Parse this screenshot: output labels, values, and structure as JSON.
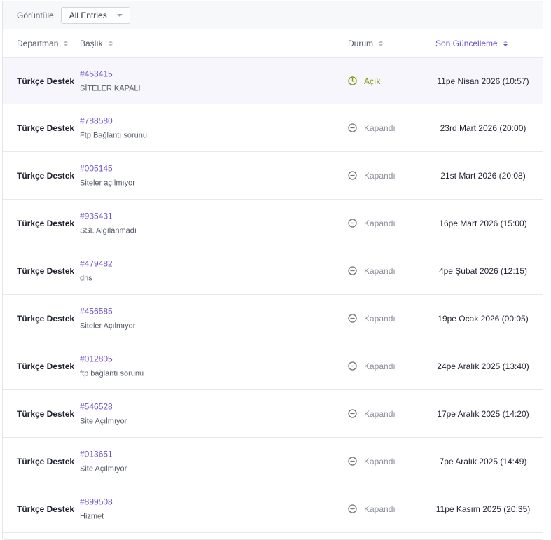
{
  "filter": {
    "label": "Görüntüle",
    "selected": "All Entries"
  },
  "columns": {
    "department": "Departman",
    "title": "Başlık",
    "status": "Durum",
    "updated": "Son Güncelleme"
  },
  "colors": {
    "accent": "#6f52c7",
    "open": "#7a9a10",
    "closed": "#8a8f99"
  },
  "tickets": [
    {
      "department": "Türkçe Destek",
      "id": "#453415",
      "subject": "SİTELER KAPALI",
      "status": "Açık",
      "status_key": "open",
      "updated": "11pe Nisan 2026 (10:57)"
    },
    {
      "department": "Türkçe Destek",
      "id": "#788580",
      "subject": "Ftp Bağlantı sorunu",
      "status": "Kapandı",
      "status_key": "closed",
      "updated": "23rd Mart 2026 (20:00)"
    },
    {
      "department": "Türkçe Destek",
      "id": "#005145",
      "subject": "Siteler açılmıyor",
      "status": "Kapandı",
      "status_key": "closed",
      "updated": "21st Mart 2026 (20:08)"
    },
    {
      "department": "Türkçe Destek",
      "id": "#935431",
      "subject": "SSL Algılanmadı",
      "status": "Kapandı",
      "status_key": "closed",
      "updated": "16pe Mart 2026 (15:00)"
    },
    {
      "department": "Türkçe Destek",
      "id": "#479482",
      "subject": "dns",
      "status": "Kapandı",
      "status_key": "closed",
      "updated": "4pe Şubat 2026 (12:15)"
    },
    {
      "department": "Türkçe Destek",
      "id": "#456585",
      "subject": "Siteler Açılmıyor",
      "status": "Kapandı",
      "status_key": "closed",
      "updated": "19pe Ocak 2026 (00:05)"
    },
    {
      "department": "Türkçe Destek",
      "id": "#012805",
      "subject": "ftp bağlantı sorunu",
      "status": "Kapandı",
      "status_key": "closed",
      "updated": "24pe Aralık 2025 (13:40)"
    },
    {
      "department": "Türkçe Destek",
      "id": "#546528",
      "subject": "Site Açılmıyor",
      "status": "Kapandı",
      "status_key": "closed",
      "updated": "17pe Aralık 2025 (14:20)"
    },
    {
      "department": "Türkçe Destek",
      "id": "#013651",
      "subject": "Site Açılmıyor",
      "status": "Kapandı",
      "status_key": "closed",
      "updated": "7pe Aralık 2025 (14:49)"
    },
    {
      "department": "Türkçe Destek",
      "id": "#899508",
      "subject": "Hizmet",
      "status": "Kapandı",
      "status_key": "closed",
      "updated": "11pe Kasım 2025 (20:35)"
    }
  ]
}
